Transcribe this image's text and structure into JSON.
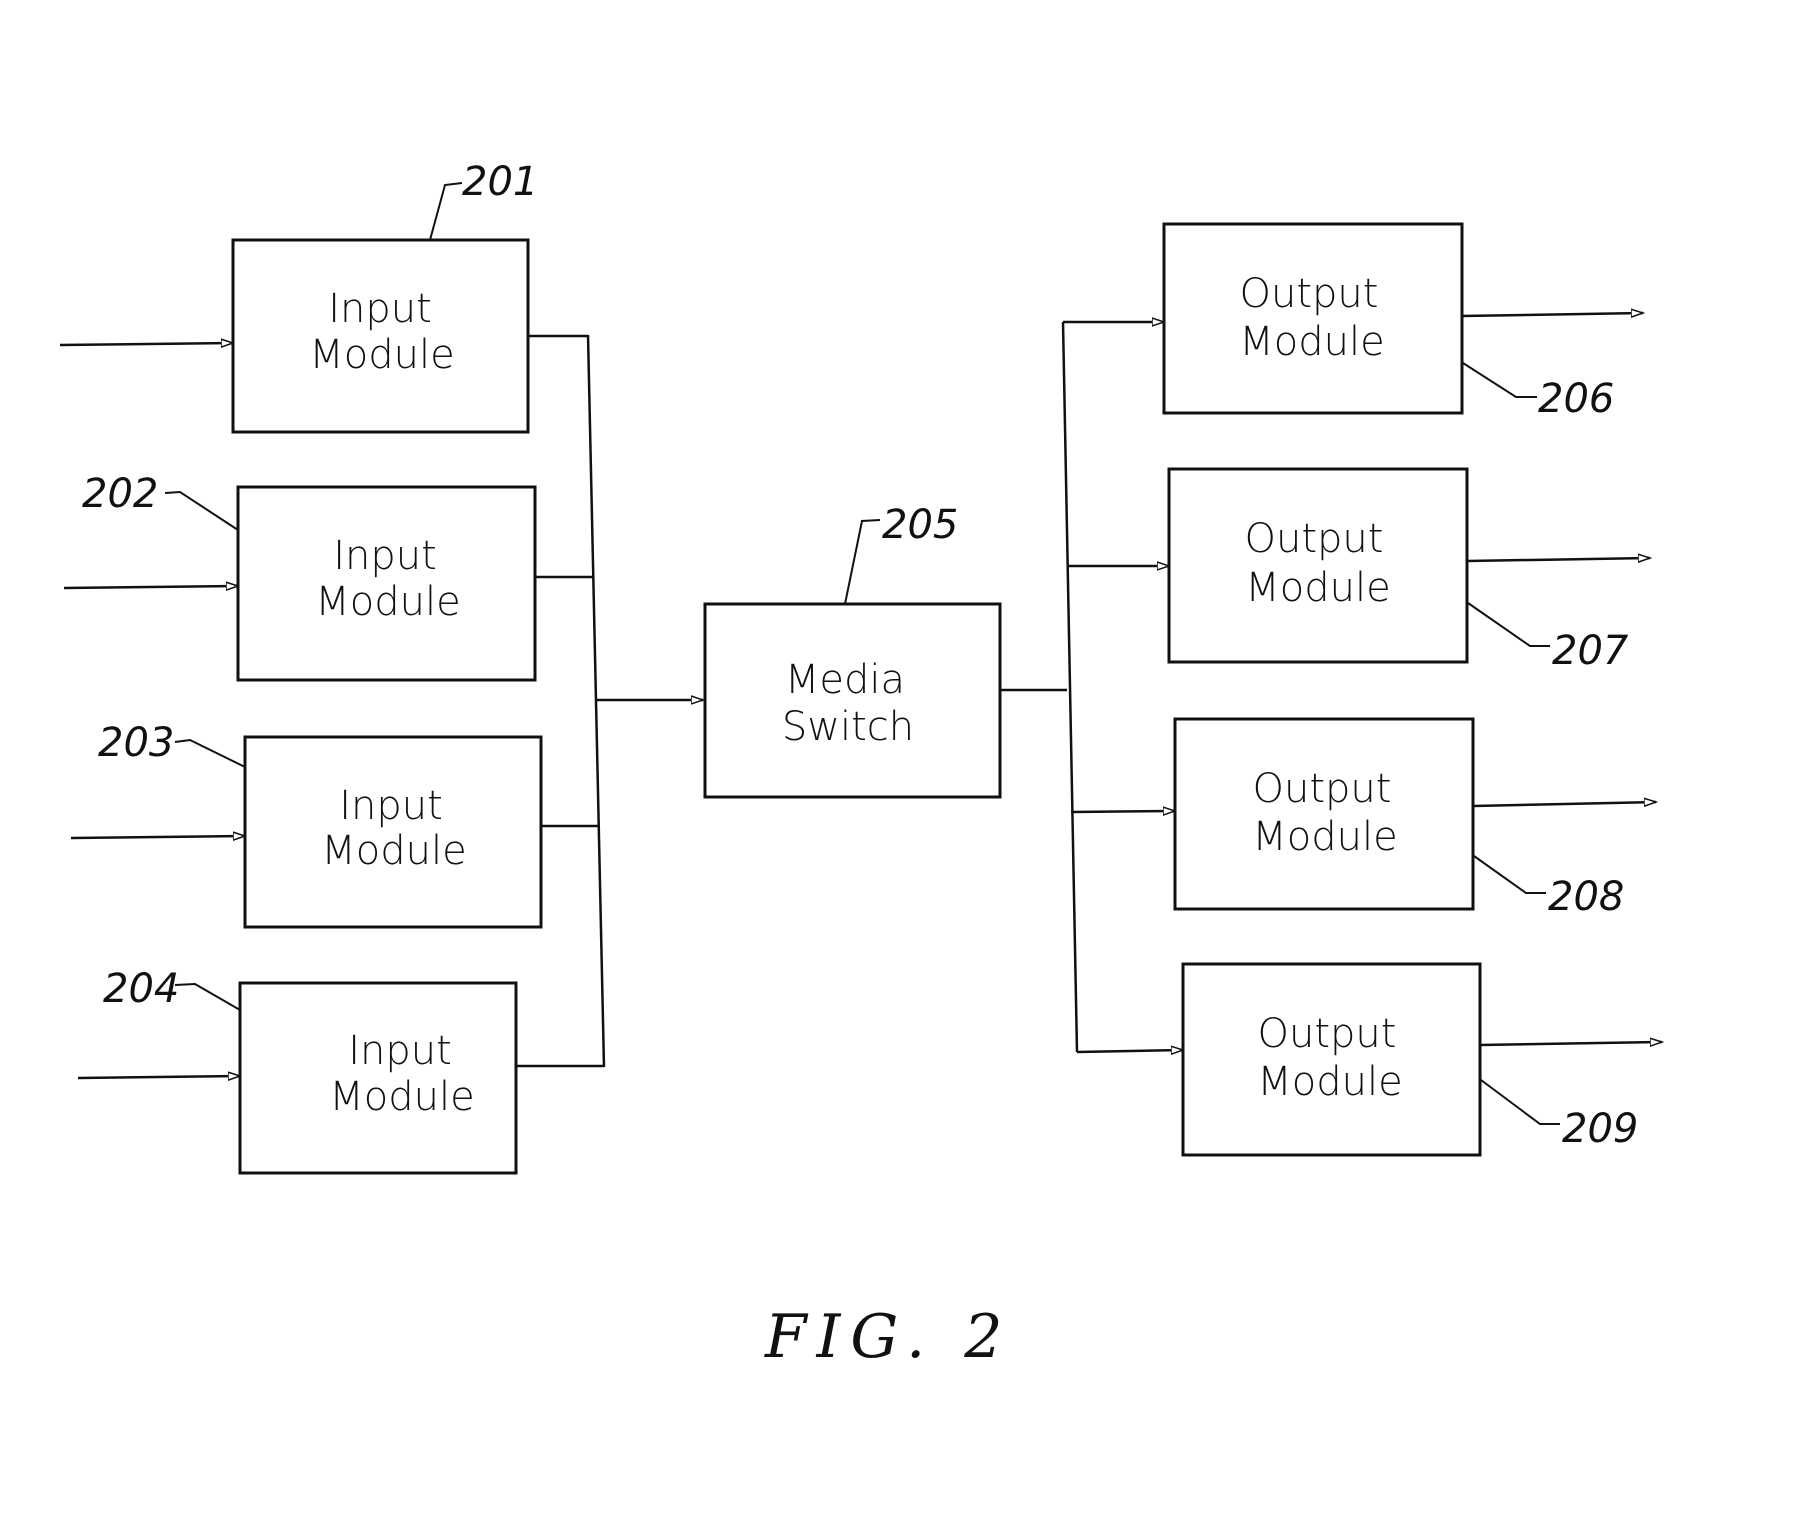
{
  "figure": {
    "caption": "FIG. 2"
  },
  "media_switch": {
    "ref": "205",
    "line1": "Media",
    "line2": "Switch"
  },
  "input_modules": [
    {
      "ref": "201",
      "line1": "Input",
      "line2": "Module"
    },
    {
      "ref": "202",
      "line1": "Input",
      "line2": "Module"
    },
    {
      "ref": "203",
      "line1": "Input",
      "line2": "Module"
    },
    {
      "ref": "204",
      "line1": "Input",
      "line2": "Module"
    }
  ],
  "output_modules": [
    {
      "ref": "206",
      "line1": "Output",
      "line2": "Module"
    },
    {
      "ref": "207",
      "line1": "Output",
      "line2": "Module"
    },
    {
      "ref": "208",
      "line1": "Output",
      "line2": "Module"
    },
    {
      "ref": "209",
      "line1": "Output",
      "line2": "Module"
    }
  ],
  "colors": {
    "ink": "#111111",
    "paper": "#ffffff"
  }
}
